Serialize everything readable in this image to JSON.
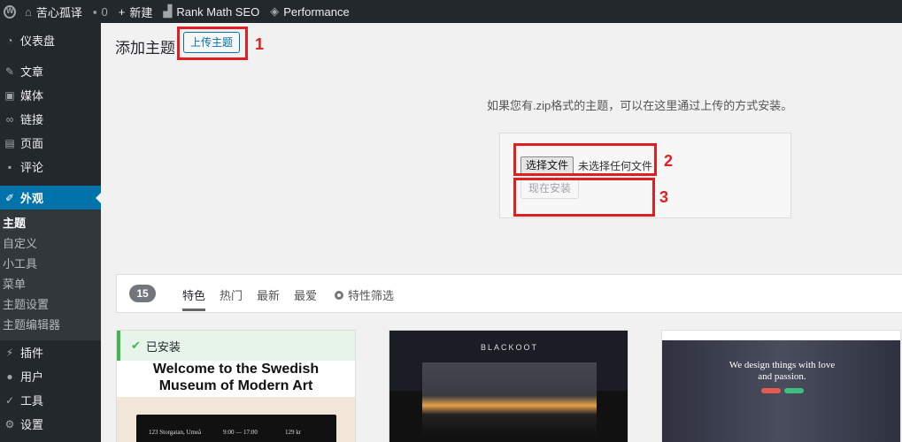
{
  "adminbar": {
    "site_name": "苦心孤译",
    "comments_count": "0",
    "new_label": "新建",
    "seo_label": "Rank Math SEO",
    "performance_label": "Performance"
  },
  "sidebar": {
    "items": [
      {
        "label": "仪表盘",
        "icon": "dashboard-icon"
      },
      {
        "label": "文章",
        "icon": "pin-icon"
      },
      {
        "label": "媒体",
        "icon": "media-icon"
      },
      {
        "label": "链接",
        "icon": "link-icon"
      },
      {
        "label": "页面",
        "icon": "page-icon"
      },
      {
        "label": "评论",
        "icon": "comment-icon"
      },
      {
        "label": "外观",
        "icon": "brush-icon"
      },
      {
        "label": "插件",
        "icon": "plugin-icon"
      },
      {
        "label": "用户",
        "icon": "user-icon"
      },
      {
        "label": "工具",
        "icon": "wrench-icon"
      },
      {
        "label": "设置",
        "icon": "settings-icon"
      }
    ],
    "submenu": [
      "主题",
      "自定义",
      "小工具",
      "菜单",
      "主题设置",
      "主题编辑器"
    ]
  },
  "page": {
    "title": "添加主题",
    "upload_button": "上传主题",
    "help_text": "如果您有.zip格式的主题，可以在这里通过上传的方式安装。",
    "choose_file": "选择文件",
    "no_file": "未选择任何文件",
    "install_now": "现在安装"
  },
  "annotations": {
    "one": "1",
    "two": "2",
    "three": "3"
  },
  "filter": {
    "count": "15",
    "tabs": [
      "特色",
      "热门",
      "最新",
      "最爱"
    ],
    "feature_filter": "特性筛选"
  },
  "themes": {
    "installed_label": "已安装",
    "card1_title_line1": "Welcome to the Swedish",
    "card1_title_line2": "Museum of Modern Art",
    "card1_addr1": "123 Storgatan, Umeå",
    "card1_addr2": "9:00 — 17:00",
    "card1_addr3": "129 kr",
    "card2_title": "BLACKOOT",
    "card3_text_line1": "We design things with love",
    "card3_text_line2": "and passion."
  },
  "colors": {
    "accent": "#0073aa",
    "sidebar": "#23282d",
    "annotation_red": "#e02020",
    "installed_green": "#46b450"
  }
}
